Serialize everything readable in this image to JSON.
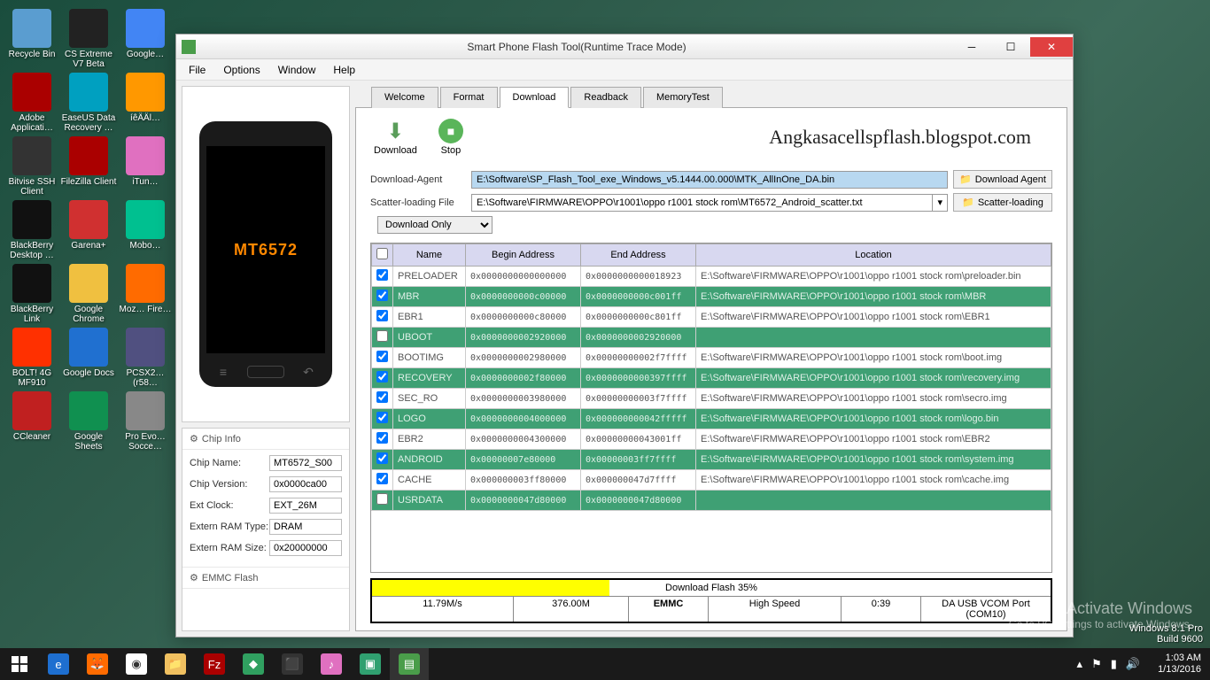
{
  "desktop": {
    "icons": [
      {
        "label": "Recycle Bin",
        "color": "#5a9dd0"
      },
      {
        "label": "CS Extreme V7 Beta",
        "color": "#222"
      },
      {
        "label": "Google…",
        "color": "#4285f4"
      },
      {
        "label": "Adobe Applicati…",
        "color": "#a00"
      },
      {
        "label": "EaseUS Data Recovery …",
        "color": "#00a0c0"
      },
      {
        "label": "íêÄÄl…",
        "color": "#ff9800"
      },
      {
        "label": "Bitvise SSH Client",
        "color": "#333"
      },
      {
        "label": "FileZilla Client",
        "color": "#a00"
      },
      {
        "label": "iTun…",
        "color": "#e070c0"
      },
      {
        "label": "BlackBerry Desktop …",
        "color": "#111"
      },
      {
        "label": "Garena+",
        "color": "#d03030"
      },
      {
        "label": "Mobo…",
        "color": "#00c090"
      },
      {
        "label": "BlackBerry Link",
        "color": "#111"
      },
      {
        "label": "Google Chrome",
        "color": "#f0c040"
      },
      {
        "label": "Moz… Fire…",
        "color": "#ff6b00"
      },
      {
        "label": "BOLT! 4G MF910",
        "color": "#ff3000"
      },
      {
        "label": "Google Docs",
        "color": "#2070d0"
      },
      {
        "label": "PCSX2… (r58…",
        "color": "#505080"
      },
      {
        "label": "CCleaner",
        "color": "#c02020"
      },
      {
        "label": "Google Sheets",
        "color": "#109050"
      },
      {
        "label": "Pro Evo… Socce…",
        "color": "#888"
      }
    ]
  },
  "window": {
    "title": "Smart Phone Flash Tool(Runtime Trace Mode)",
    "menu": [
      "File",
      "Options",
      "Window",
      "Help"
    ],
    "phone_chip": "MT6572",
    "chip_info_head": "Chip Info",
    "emmc_head": "EMMC Flash",
    "chip_info": [
      {
        "k": "Chip Name:",
        "v": "MT6572_S00"
      },
      {
        "k": "Chip Version:",
        "v": "0x0000ca00"
      },
      {
        "k": "Ext Clock:",
        "v": "EXT_26M"
      },
      {
        "k": "Extern RAM Type:",
        "v": "DRAM"
      },
      {
        "k": "Extern RAM Size:",
        "v": "0x20000000"
      }
    ],
    "tabs": [
      "Welcome",
      "Format",
      "Download",
      "Readback",
      "MemoryTest"
    ],
    "active_tab": "Download",
    "toolbar": {
      "download": "Download",
      "stop": "Stop"
    },
    "watermark": "Angkasacellspflash.blogspot.com",
    "agent_lbl": "Download-Agent",
    "agent_path": "E:\\Software\\SP_Flash_Tool_exe_Windows_v5.1444.00.000\\MTK_AllInOne_DA.bin",
    "agent_btn": "Download Agent",
    "scatter_lbl": "Scatter-loading File",
    "scatter_path": "E:\\Software\\FIRMWARE\\OPPO\\r1001\\oppo r1001 stock rom\\MT6572_Android_scatter.txt",
    "scatter_btn": "Scatter-loading",
    "mode": "Download Only",
    "cols": [
      "",
      "Name",
      "Begin Address",
      "End Address",
      "Location"
    ],
    "rows": [
      {
        "c": true,
        "n": "PRELOADER",
        "b": "0x0000000000000000",
        "e": "0x0000000000018923",
        "l": "E:\\Software\\FIRMWARE\\OPPO\\r1001\\oppo r1001 stock rom\\preloader.bin",
        "g": false
      },
      {
        "c": true,
        "n": "MBR",
        "b": "0x0000000000c00000",
        "e": "0x0000000000c001ff",
        "l": "E:\\Software\\FIRMWARE\\OPPO\\r1001\\oppo r1001 stock rom\\MBR",
        "g": true
      },
      {
        "c": true,
        "n": "EBR1",
        "b": "0x0000000000c80000",
        "e": "0x0000000000c801ff",
        "l": "E:\\Software\\FIRMWARE\\OPPO\\r1001\\oppo r1001 stock rom\\EBR1",
        "g": false
      },
      {
        "c": false,
        "n": "UBOOT",
        "b": "0x0000000002920000",
        "e": "0x0000000002920000",
        "l": "",
        "g": true
      },
      {
        "c": true,
        "n": "BOOTIMG",
        "b": "0x0000000002980000",
        "e": "0x00000000002f7ffff",
        "l": "E:\\Software\\FIRMWARE\\OPPO\\r1001\\oppo r1001 stock rom\\boot.img",
        "g": false
      },
      {
        "c": true,
        "n": "RECOVERY",
        "b": "0x0000000002f80000",
        "e": "0x0000000000397ffff",
        "l": "E:\\Software\\FIRMWARE\\OPPO\\r1001\\oppo r1001 stock rom\\recovery.img",
        "g": true
      },
      {
        "c": true,
        "n": "SEC_RO",
        "b": "0x0000000003980000",
        "e": "0x00000000003f7ffff",
        "l": "E:\\Software\\FIRMWARE\\OPPO\\r1001\\oppo r1001 stock rom\\secro.img",
        "g": false
      },
      {
        "c": true,
        "n": "LOGO",
        "b": "0x0000000004000000",
        "e": "0x000000000042fffff",
        "l": "E:\\Software\\FIRMWARE\\OPPO\\r1001\\oppo r1001 stock rom\\logo.bin",
        "g": true
      },
      {
        "c": true,
        "n": "EBR2",
        "b": "0x0000000004300000",
        "e": "0x00000000043001ff",
        "l": "E:\\Software\\FIRMWARE\\OPPO\\r1001\\oppo r1001 stock rom\\EBR2",
        "g": false
      },
      {
        "c": true,
        "n": "ANDROID",
        "b": "0x00000007e80000",
        "e": "0x00000003ff7ffff",
        "l": "E:\\Software\\FIRMWARE\\OPPO\\r1001\\oppo r1001 stock rom\\system.img",
        "g": true
      },
      {
        "c": true,
        "n": "CACHE",
        "b": "0x000000003ff80000",
        "e": "0x000000047d7ffff",
        "l": "E:\\Software\\FIRMWARE\\OPPO\\r1001\\oppo r1001 stock rom\\cache.img",
        "g": false
      },
      {
        "c": false,
        "n": "USRDATA",
        "b": "0x0000000047d80000",
        "e": "0x0000000047d80000",
        "l": "",
        "g": true
      }
    ],
    "progress": {
      "label": "Download Flash 35%",
      "pct": 35,
      "speed": "11.79M/s",
      "size": "376.00M",
      "storage": "EMMC",
      "speed_lbl": "High Speed",
      "eta": "0:39",
      "port": "DA USB VCOM Port (COM10)"
    }
  },
  "activate": {
    "l1": "Activate Windows",
    "l2": "Go to PC settings to activate Windows."
  },
  "build": {
    "l1": "Windows 8.1 Pro",
    "l2": "Build 9600"
  },
  "tray": {
    "time": "1:03 AM",
    "date": "1/13/2016"
  }
}
